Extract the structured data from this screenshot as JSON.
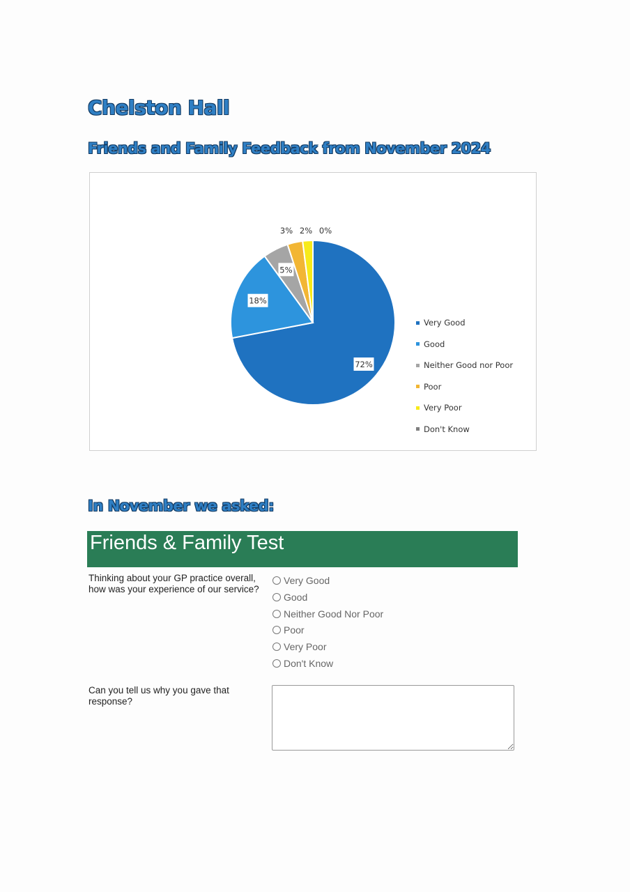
{
  "title": "Chelston Hall",
  "subtitle": "Friends and Family Feedback from November 2024",
  "chart_data": {
    "type": "pie",
    "categories": [
      "Very Good",
      "Good",
      "Neither Good nor Poor",
      "Poor",
      "Very Poor",
      "Don't Know"
    ],
    "values": [
      72,
      18,
      5,
      3,
      2,
      0
    ],
    "labels": [
      "72%",
      "18%",
      "5%",
      "3%",
      "2%",
      "0%"
    ],
    "colors": [
      "#1f72c0",
      "#2d94dd",
      "#a5a5a5",
      "#f2b634",
      "#f7ea1a",
      "#7f7f7f"
    ],
    "start": "top",
    "direction": "clockwise",
    "legend_position": "right"
  },
  "asked_heading": "In November we asked:",
  "form": {
    "banner": "Friends & Family Test",
    "banner_color": "#2a7d56",
    "question1": "Thinking about your GP practice overall, how was your experience of our service?",
    "options": [
      "Very Good",
      "Good",
      "Neither Good Nor Poor",
      "Poor",
      "Very Poor",
      "Don't Know"
    ],
    "question2": "Can you tell us why you gave that response?",
    "reason_value": ""
  }
}
